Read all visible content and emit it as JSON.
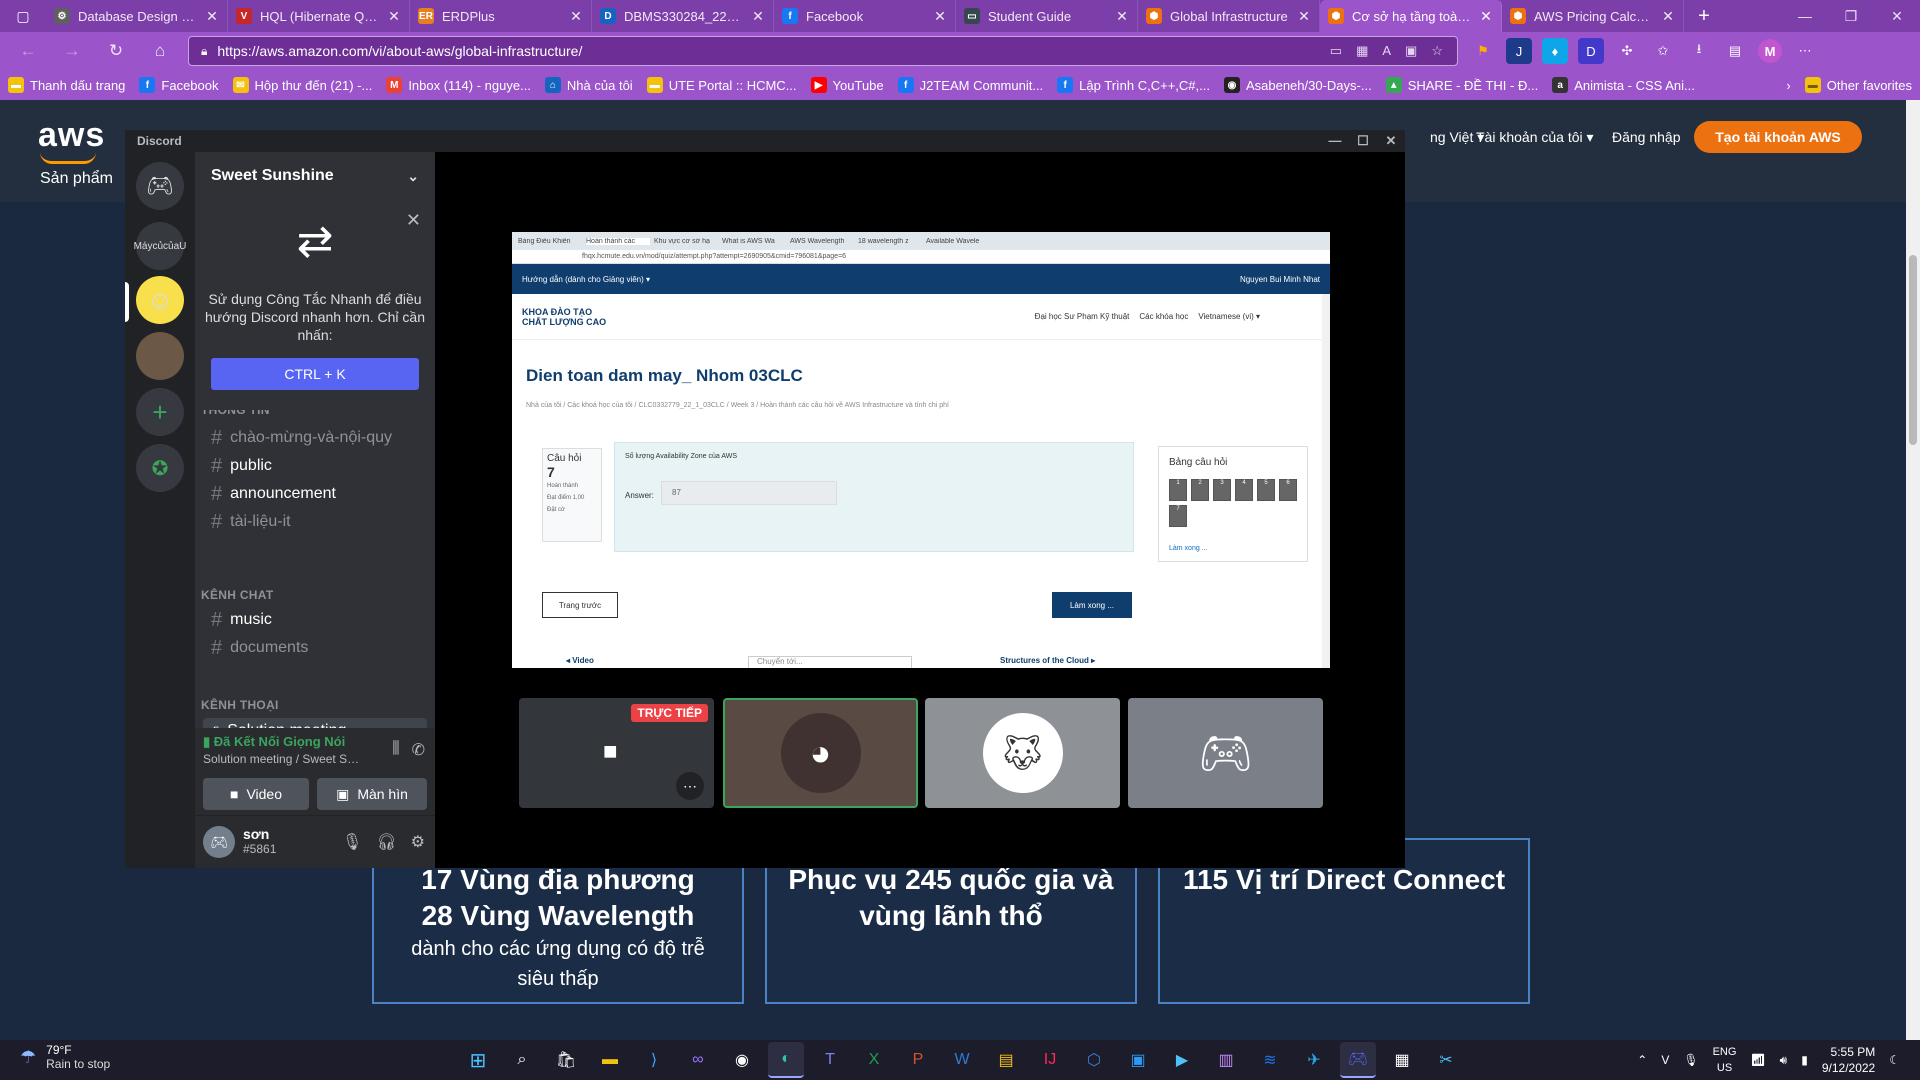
{
  "browser": {
    "tabs": [
      {
        "title": "Database Design of O",
        "icon": "database-icon",
        "color": "#5f5f5f",
        "glyph": "⚙"
      },
      {
        "title": "HQL (Hibernate Query",
        "icon": "hql-icon",
        "color": "#c62828",
        "glyph": "V"
      },
      {
        "title": "ERDPlus",
        "icon": "erdplus-icon",
        "color": "#e67e22",
        "glyph": "ER"
      },
      {
        "title": "DBMS330284_22_1_02",
        "icon": "dbms-icon",
        "color": "#1565c0",
        "glyph": "D"
      },
      {
        "title": "Facebook",
        "icon": "facebook-icon",
        "color": "#1877f2",
        "glyph": "f"
      },
      {
        "title": "Student Guide",
        "icon": "student-guide-icon",
        "color": "#37474f",
        "glyph": "▭"
      },
      {
        "title": "Global Infrastructure",
        "icon": "aws-icon",
        "color": "#ec7211",
        "glyph": "⬢"
      },
      {
        "title": "Cơ sở hạ tầng toàn cầ",
        "icon": "aws-icon",
        "color": "#ec7211",
        "glyph": "⬢",
        "active": true
      },
      {
        "title": "AWS Pricing Calculato",
        "icon": "aws-icon",
        "color": "#ec7211",
        "glyph": "⬢"
      }
    ],
    "url": "https://aws.amazon.com/vi/about-aws/global-infrastructure/",
    "profile_letter": "M",
    "bookmarks": [
      {
        "label": "Thanh dấu trang",
        "icon": "folder-icon",
        "color": "#f4c20d",
        "glyph": "▬"
      },
      {
        "label": "Facebook",
        "icon": "facebook-icon",
        "color": "#1877f2",
        "glyph": "f"
      },
      {
        "label": "Hộp thư đến (21) -...",
        "icon": "mail-icon",
        "color": "#f4c20d",
        "glyph": "✉"
      },
      {
        "label": "Inbox (114) - nguye...",
        "icon": "gmail-icon",
        "color": "#ea4335",
        "glyph": "M"
      },
      {
        "label": "Nhà của tôi",
        "icon": "home-icon",
        "color": "#1565c0",
        "glyph": "⌂"
      },
      {
        "label": "UTE Portal :: HCMC...",
        "icon": "folder-icon",
        "color": "#f4c20d",
        "glyph": "▬"
      },
      {
        "label": "YouTube",
        "icon": "youtube-icon",
        "color": "#ff0000",
        "glyph": "▶"
      },
      {
        "label": "J2TEAM Communit...",
        "icon": "facebook-icon",
        "color": "#1877f2",
        "glyph": "f"
      },
      {
        "label": "Lập Trình C,C++,C#,...",
        "icon": "facebook-icon",
        "color": "#1877f2",
        "glyph": "f"
      },
      {
        "label": "Asabeneh/30-Days-...",
        "icon": "github-icon",
        "color": "#222",
        "glyph": "◉"
      },
      {
        "label": "SHARE - ĐỀ THI - Đ...",
        "icon": "drive-icon",
        "color": "#34a853",
        "glyph": "▲"
      },
      {
        "label": "Animista - CSS Ani...",
        "icon": "animista-icon",
        "color": "#333",
        "glyph": "a"
      }
    ],
    "other_favorites": "Other favorites"
  },
  "aws": {
    "logo": "aws",
    "products": "Sản phẩm",
    "language": "ng Việt ▾",
    "account": "Tài khoản của tôi ▾",
    "login": "Đăng nhập",
    "signup": "Tạo tài khoản AWS",
    "stats": [
      {
        "big": "17 Vùng địa phương",
        "big2": "28 Vùng Wavelength",
        "small": "dành cho các ứng dụng có độ trễ siêu thấp"
      },
      {
        "big": "Phục vụ 245 quốc gia và vùng lãnh thổ"
      },
      {
        "big": "115 Vị trí Direct Connect"
      }
    ]
  },
  "discord": {
    "app_title": "Discord",
    "server_name": "Sweet Sunshine",
    "guild_label": "MáycủcủaU",
    "popup": {
      "message": "Sử dụng Công Tắc Nhanh để điều hướng Discord nhanh hơn. Chỉ cần nhấn:",
      "shortcut": "CTRL + K"
    },
    "cropped_category": "THÔNG TIN",
    "channels_info": [
      {
        "name": "chào-mừng-và-nội-quy",
        "unread": false
      },
      {
        "name": "public",
        "unread": true
      },
      {
        "name": "announcement",
        "unread": true
      },
      {
        "name": "tài-liệu-it",
        "unread": false
      }
    ],
    "cat_chat": "KÊNH CHAT",
    "channels_chat": [
      {
        "name": "music",
        "unread": true
      },
      {
        "name": "documents",
        "unread": false
      }
    ],
    "cat_voice": "KÊNH THOẠI",
    "voice_channel": "Solution meeting",
    "voice_status": "Đã Kết Nối Giọng Nói",
    "voice_sub": "Solution meeting / Sweet Su...",
    "video_label": "Video",
    "screen_label": "Màn hìn",
    "user": {
      "name": "sơn",
      "tag": "#5861"
    },
    "live_badge": "TRỰC TIẾP"
  },
  "stream": {
    "tabs": [
      "Bảng Điều Khiển",
      "Hoàn thành các",
      "Khu vực cơ sở hạ",
      "What is AWS Wa",
      "AWS Wavelength",
      "18 wavelength z",
      "Available Wavele"
    ],
    "url": "fhqx.hcmute.edu.vn/mod/quiz/attempt.php?attempt=2690905&cmid=796081&page=6",
    "nav_left": "Hướng dẫn (dành cho Giảng viên) ▾",
    "nav_right": "Nguyen Bui Minh Nhat",
    "logo_line1": "KHOA ĐÀO TẠO",
    "logo_line2": "CHẤT LƯỢNG CAO",
    "links": [
      "Đại học Sư Phạm Kỹ thuật",
      "Các khóa học",
      "Vietnamese (vi) ▾"
    ],
    "course_title": "Dien toan dam may_ Nhom 03CLC",
    "breadcrumb": "Nhà của tôi / Các khoá học của tôi / CLC0332779_22_1_03CLC / Week 3 / Hoàn thành các câu hỏi về AWS Infrastructure và tính chi phí",
    "question_label": "Câu hỏi",
    "question_number": "7",
    "question_meta": [
      "Hoàn thành",
      "Đạt điểm 1,00",
      "Đặt cờ"
    ],
    "question_text": "Số lượng Availability Zone của AWS",
    "answer_label": "Answer:",
    "answer_value": "87",
    "nav_panel_title": "Bảng câu hỏi",
    "nav_cells": [
      "1",
      "2",
      "3",
      "4",
      "5",
      "6",
      "7"
    ],
    "finish_attempt": "Làm xong ...",
    "prev_button": "Trang trước",
    "finish_button": "Làm xong ...",
    "footer_left": "◂ Video",
    "footer_select": "Chuyển tới...",
    "footer_right": "Structures of the Cloud ▸"
  },
  "taskbar": {
    "temp": "79°F",
    "weather": "Rain to stop",
    "lang1": "ENG",
    "lang2": "US",
    "time": "5:55 PM",
    "date": "9/12/2022"
  }
}
